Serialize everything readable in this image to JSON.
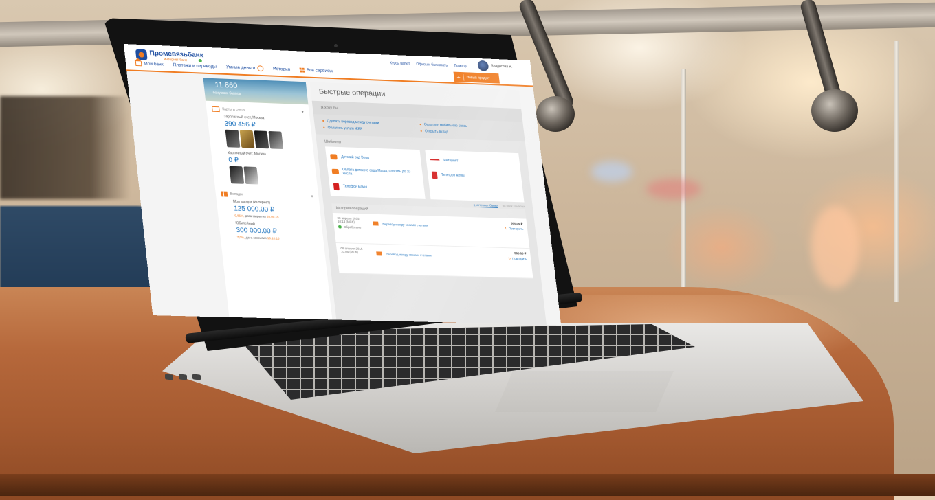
{
  "bank": {
    "name": "Промсвязьбанк",
    "subtitle": "интернет-банк"
  },
  "header": {
    "top_links": [
      "Курсы валют",
      "Офисы и банкоматы",
      "Помощь"
    ],
    "user_name": "Владислав Н.",
    "menu": [
      "Мой банк",
      "Платежи и переводы",
      "Умные деньги",
      "История",
      "Все сервисы"
    ],
    "new_button": "Новый продукт",
    "icons": {
      "home": "home-icon",
      "coin": "coin-icon",
      "services": "grid-icon",
      "plus": "plus-icon"
    }
  },
  "sidebar": {
    "banner_amount": "11 860",
    "banner_label": "бонусных баллов",
    "cards_section": "Карты и счета",
    "accounts": [
      {
        "name": "Зарплатный счет, Москва",
        "amount": "390 456 ₽"
      },
      {
        "name": "Карточный счет, Москва",
        "amount": "0 ₽"
      }
    ],
    "deposits_section": "Вклады",
    "deposits": [
      {
        "name": "Моя выгода (Интернет)",
        "amount": "125 000.00 ₽",
        "rate": "9,85%,",
        "note": "дата закрытия",
        "date": "20.09.15"
      },
      {
        "name": "Юбилейный",
        "amount": "300 000.00 ₽",
        "rate": "7,0%,",
        "note": "дата закрытия",
        "date": "10.10.15"
      }
    ]
  },
  "main": {
    "title": "Быстрые операции",
    "want_label": "Я хочу бы...",
    "quick_ops": [
      "Сделать перевод между счетами",
      "Оплатить мобильную связь",
      "Оплатить услуги ЖКХ",
      "Открыть вклад"
    ],
    "templates_title": "Шаблоны",
    "templates_left": [
      "Детский сад Вера",
      "Оплата детского сада Маша, платить до 10 числа",
      "Телефон мамы"
    ],
    "templates_right": [
      "Интернет",
      "Телефон жены"
    ],
    "history_links": [
      "в интернет-банке",
      "во всех каналах"
    ],
    "history_title": "История операций",
    "history": [
      {
        "date": "08 апреля 2015",
        "time": "10:13 (МСК)",
        "name": "Перевод между своими счетами",
        "amount": "500,00 ₽",
        "repeat": "Повторить",
        "status": "Обработано"
      },
      {
        "date": "08 апреля 2015",
        "time": "10:05 (МСК)",
        "name": "Перевод между своими счетами",
        "amount": "500,00 ₽",
        "repeat": "Повторить",
        "status": ""
      }
    ]
  },
  "colors": {
    "accent": "#f07d23",
    "brand": "#1e4ea1",
    "link": "#1e73be",
    "success": "#4bb34b"
  }
}
